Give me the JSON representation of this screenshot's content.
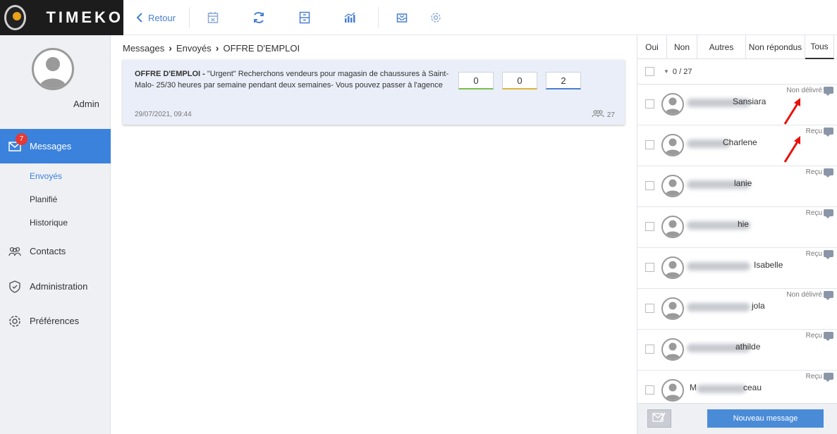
{
  "brand": {
    "logo_text": "TIMEKO"
  },
  "toolbar": {
    "back_label": "Retour",
    "icons": [
      "calendar-icon",
      "refresh-icon",
      "archive-icon",
      "stats-icon",
      "inbox-icon",
      "gear-icon"
    ]
  },
  "sidebar": {
    "user_name": "Admin",
    "messages_label": "Messages",
    "messages_badge": "7",
    "sub_items": [
      {
        "label": "Envoyés",
        "active": true
      },
      {
        "label": "Planifié",
        "active": false
      },
      {
        "label": "Historique",
        "active": false
      }
    ],
    "contacts_label": "Contacts",
    "administration_label": "Administration",
    "preferences_label": "Préférences"
  },
  "breadcrumb": [
    "Messages",
    "Envoyés",
    "OFFRE D'EMPLOI"
  ],
  "message": {
    "title": "OFFRE D'EMPLOI - ",
    "body": "\"Urgent\" Recherchons vendeurs pour magasin de chaussures à Saint-Malo- 25/30 heures par semaine pendant deux semaines- Vous pouvez passer à l'agence",
    "date": "29/07/2021, 09:44",
    "counts": [
      "0",
      "0",
      "2"
    ],
    "count_colors": [
      "#7bbf4a",
      "#e0b53a",
      "#4a7fd0"
    ],
    "recipients": "27"
  },
  "panel": {
    "tabs": [
      {
        "label": "Oui",
        "active": false
      },
      {
        "label": "Non",
        "active": false
      },
      {
        "label": "Autres",
        "active": false
      },
      {
        "label": "Non répondus",
        "active": false
      },
      {
        "label": "Tous",
        "active": true
      }
    ],
    "selection": "0 / 27",
    "recipients": [
      {
        "name": "Sansiara",
        "status": "Non délivré"
      },
      {
        "name": "Charlene",
        "status": "Reçu"
      },
      {
        "name": "lanie",
        "status": "Reçu"
      },
      {
        "name": "hie",
        "status": "Reçu"
      },
      {
        "name": "Isabelle",
        "status": "Reçu"
      },
      {
        "name": "jola",
        "status": "Non délivré"
      },
      {
        "name": "athilde",
        "status": "Reçu"
      },
      {
        "name": "ceau",
        "prefix": "M",
        "status": "Reçu"
      }
    ],
    "new_message_label": "Nouveau message"
  }
}
